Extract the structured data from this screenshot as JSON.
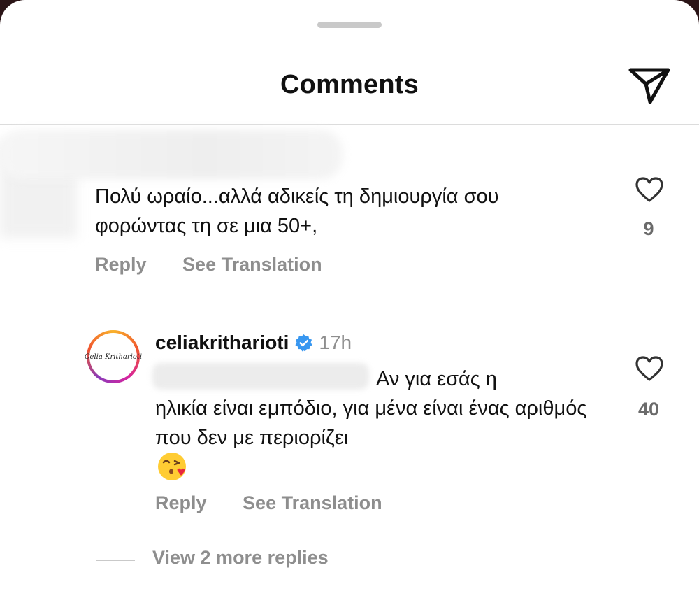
{
  "header": {
    "title": "Comments"
  },
  "comments": [
    {
      "text": "Πολύ ωραίο...αλλά αδικείς τη δημιουργία σου φορώντας τη σε μια 50+,",
      "likes": "9",
      "reply_label": "Reply",
      "translate_label": "See Translation"
    },
    {
      "username": "celiakritharioti",
      "time": "17h",
      "avatar_text": "Celia Kritharioti",
      "text_line1": "Αν για εσάς η",
      "text_rest": "ηλικία είναι εμπόδιο, για μένα είναι ένας αριθμός που δεν με περιορίζει",
      "likes": "40",
      "reply_label": "Reply",
      "translate_label": "See Translation"
    }
  ],
  "view_more_label": "View 2 more replies",
  "icons": {
    "send": "send-icon",
    "heart": "heart-icon",
    "verified": "verified-badge-icon",
    "emoji": "kiss-emoji-icon"
  },
  "colors": {
    "verified": "#3897f0",
    "muted": "#8e8e8e"
  }
}
